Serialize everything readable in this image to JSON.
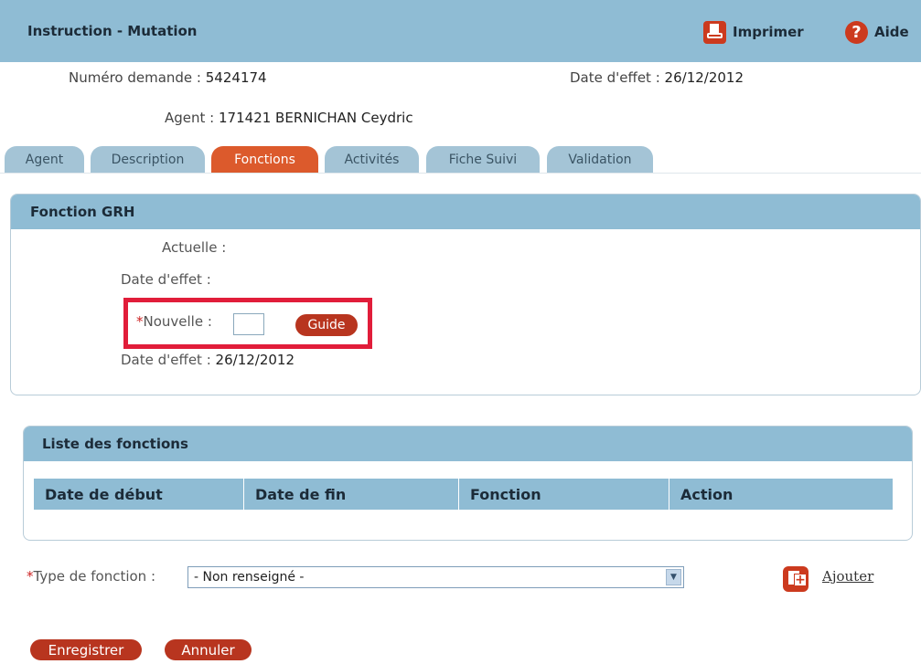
{
  "header": {
    "title": "Instruction - Mutation",
    "print_label": "Imprimer",
    "help_label": "Aide",
    "print_icon": "printer-icon",
    "help_icon": "question-icon"
  },
  "info": {
    "numero_label": "Numéro demande :",
    "numero_value": "5424174",
    "date_effet_label": "Date d'effet :",
    "date_effet_value": "26/12/2012",
    "agent_label": "Agent :",
    "agent_value": "171421 BERNICHAN Ceydric"
  },
  "tabs": [
    {
      "label": "Agent"
    },
    {
      "label": "Description"
    },
    {
      "label": "Fonctions"
    },
    {
      "label": "Activités"
    },
    {
      "label": "Fiche Suivi"
    },
    {
      "label": "Validation"
    }
  ],
  "active_tab": "Fonctions",
  "fonction_grh": {
    "title": "Fonction GRH",
    "actuelle_label": "Actuelle :",
    "date_effet_label": "Date d'effet :",
    "required_mark": "*",
    "nouvelle_label": "Nouvelle :",
    "nouvelle_value": "",
    "guide_button": "Guide",
    "date_effet_new_label": "Date d'effet :",
    "date_effet_new_value": "26/12/2012"
  },
  "liste": {
    "title": "Liste des fonctions",
    "columns": [
      "Date de début",
      "Date de fin",
      "Fonction",
      "Action"
    ]
  },
  "type_fonction": {
    "required_mark": "*",
    "label": "Type de fonction :",
    "selected": "- Non renseigné -",
    "add_label": "Ajouter",
    "add_icon": "add-document-icon"
  },
  "buttons": {
    "save": "Enregistrer",
    "cancel": "Annuler"
  },
  "colors": {
    "header_blue": "#8fbcd4",
    "accent_red": "#cc3a1e",
    "highlight_red": "#e11d3a",
    "tab_blue": "#a4c4d6",
    "tab_active": "#dc5a2c"
  }
}
